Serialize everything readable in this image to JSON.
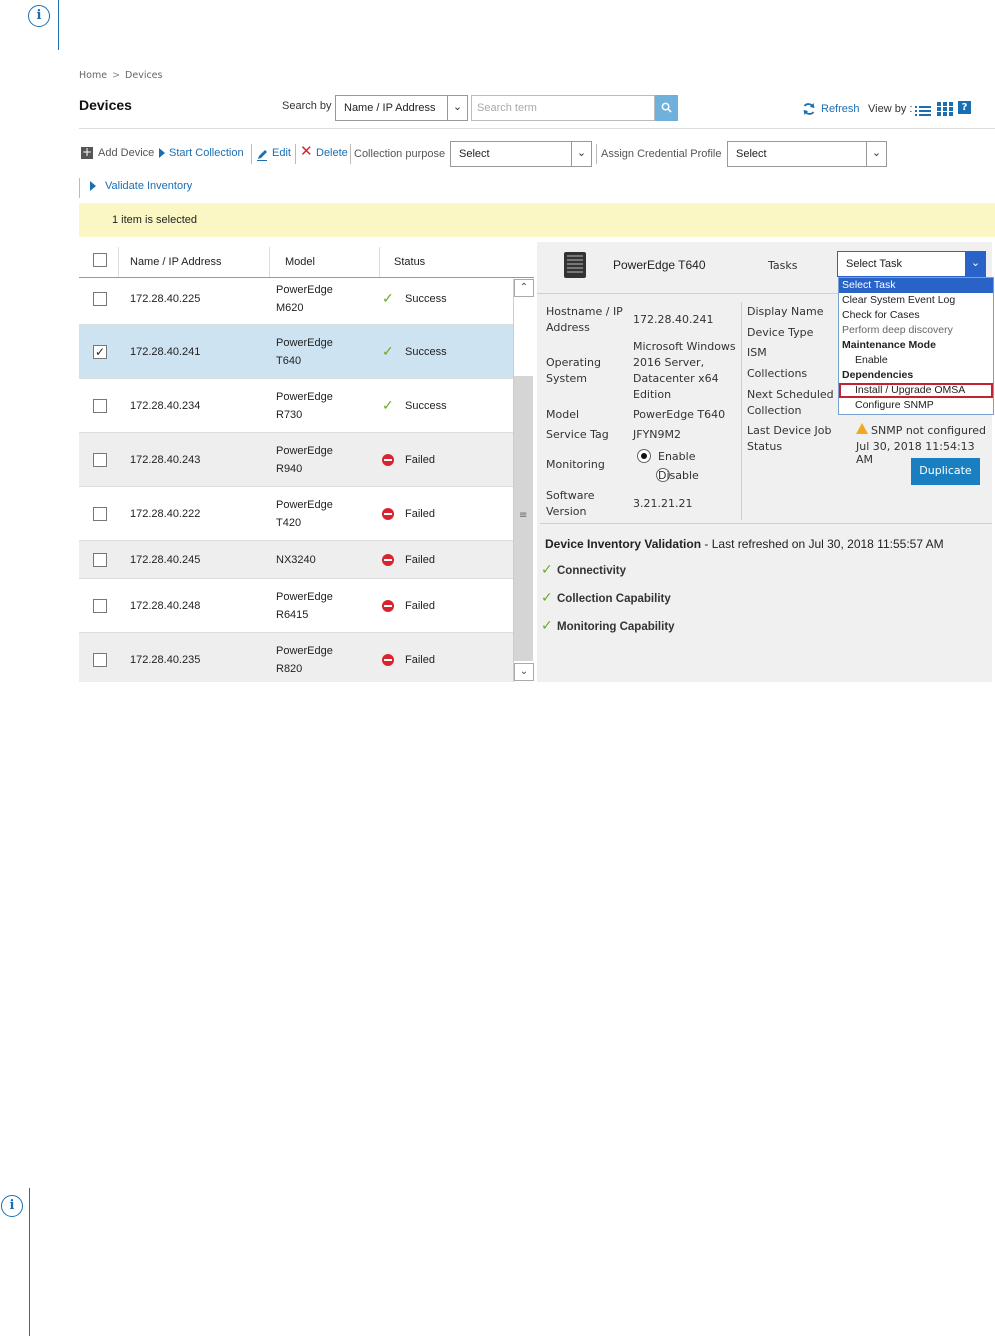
{
  "breadcrumb": {
    "home": "Home",
    "separator": ">",
    "current": "Devices"
  },
  "page": {
    "title": "Devices"
  },
  "search": {
    "label": "Search by",
    "field": "Name / IP Address",
    "placeholder": "Search term"
  },
  "header_actions": {
    "refresh": "Refresh",
    "view_by": "View by :"
  },
  "toolbar": {
    "add_device": "Add Device",
    "start_collection": "Start Collection",
    "edit": "Edit",
    "delete": "Delete",
    "collection_purpose_label": "Collection purpose",
    "collection_purpose_value": "Select",
    "assign_profile_label": "Assign Credential Profile",
    "assign_profile_value": "Select",
    "validate_inventory": "Validate Inventory"
  },
  "selection": {
    "message": "1 item is selected"
  },
  "grid": {
    "columns": [
      "Name / IP Address",
      "Model",
      "Status"
    ],
    "rows": [
      {
        "ip": "172.28.40.225",
        "model_line1": "PowerEdge",
        "model_line2": "M620",
        "status": "Success",
        "checked": false
      },
      {
        "ip": "172.28.40.241",
        "model_line1": "PowerEdge",
        "model_line2": "T640",
        "status": "Success",
        "checked": true
      },
      {
        "ip": "172.28.40.234",
        "model_line1": "PowerEdge",
        "model_line2": "R730",
        "status": "Success",
        "checked": false
      },
      {
        "ip": "172.28.40.243",
        "model_line1": "PowerEdge",
        "model_line2": "R940",
        "status": "Failed",
        "checked": false
      },
      {
        "ip": "172.28.40.222",
        "model_line1": "PowerEdge",
        "model_line2": "T420",
        "status": "Failed",
        "checked": false
      },
      {
        "ip": "172.28.40.245",
        "model_line1": "NX3240",
        "model_line2": "",
        "status": "Failed",
        "checked": false
      },
      {
        "ip": "172.28.40.248",
        "model_line1": "PowerEdge",
        "model_line2": "R6415",
        "status": "Failed",
        "checked": false
      },
      {
        "ip": "172.28.40.235",
        "model_line1": "PowerEdge",
        "model_line2": "R820",
        "status": "Failed",
        "checked": false
      }
    ]
  },
  "details": {
    "device_name": "PowerEdge T640",
    "tasks_label": "Tasks",
    "task_select_value": "Select Task",
    "hostname_label_1": "Hostname / IP",
    "hostname_label_2": "Address",
    "hostname_value": "172.28.40.241",
    "os_label_1": "Operating",
    "os_label_2": "System",
    "os_value_1": "Microsoft Windows",
    "os_value_2": "2016 Server,",
    "os_value_3": "Datacenter x64",
    "os_value_4": "Edition",
    "model_label": "Model",
    "model_value": "PowerEdge T640",
    "service_tag_label": "Service Tag",
    "service_tag_value": "JFYN9M2",
    "monitoring_label": "Monitoring",
    "monitoring_enable": "Enable",
    "monitoring_disable": "Disable",
    "software_label_1": "Software",
    "software_label_2": "Version",
    "software_value": "3.21.21.21",
    "display_name_label": "Display Name",
    "device_type_label": "Device Type",
    "ism_label": "ISM",
    "collections_label": "Collections",
    "next_scheduled_label_1": "Next Scheduled",
    "next_scheduled_label_2": "Collection",
    "last_job_label_1": "Last Device Job",
    "last_job_label_2": "Status",
    "last_job_value_1": "SNMP not configured",
    "last_job_value_2": "Jul 30, 2018 11:54:13 AM",
    "duplicate_button": "Duplicate"
  },
  "task_menu": {
    "items": [
      "Select Task",
      "Clear System Event Log",
      "Check for Cases",
      "Perform deep discovery",
      "Maintenance Mode",
      "Enable",
      "Dependencies",
      "Install / Upgrade OMSA",
      "Configure SNMP"
    ]
  },
  "validation": {
    "title": "Device Inventory Validation",
    "refreshed": "- Last refreshed on Jul 30, 2018 11:55:57 AM",
    "checks": [
      "Connectivity",
      "Collection Capability",
      "Monitoring Capability"
    ]
  },
  "colors": {
    "accent": "#1a6fb3",
    "selected_row": "#cde3f1",
    "notice_bg": "#fbf7c4",
    "success": "#6bab2b",
    "failed": "#d9232f",
    "highlight_box": "#c3232e"
  }
}
